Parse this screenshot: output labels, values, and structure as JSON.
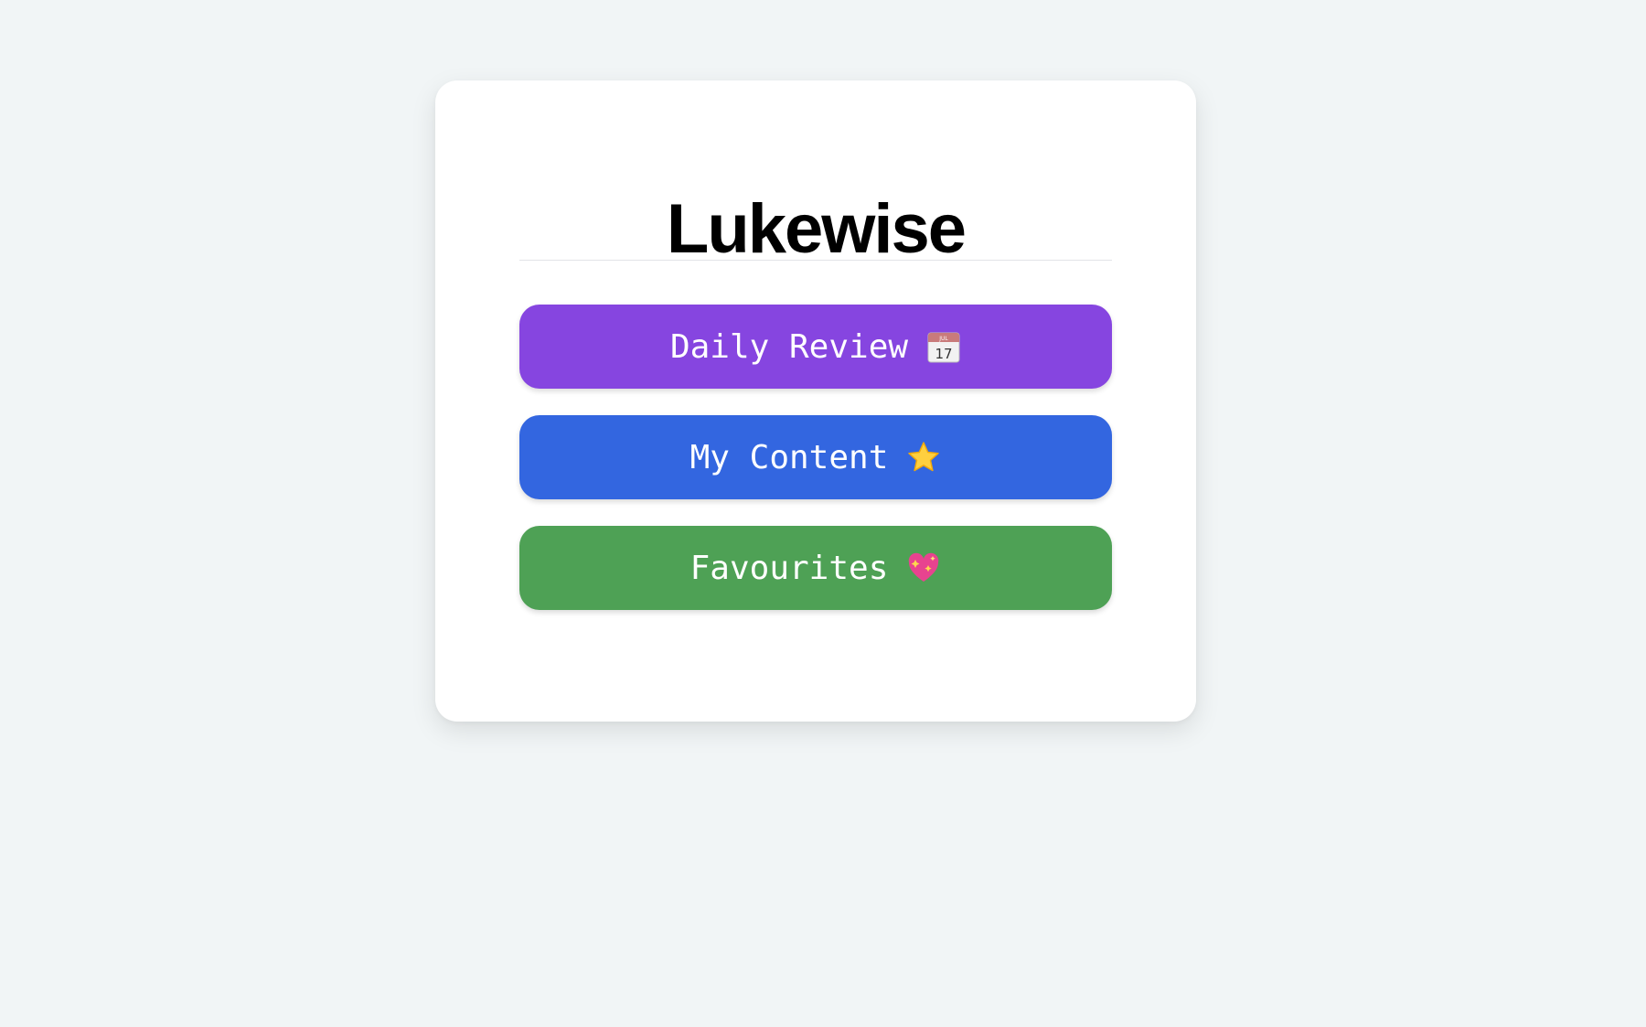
{
  "app": {
    "title": "Lukewise"
  },
  "menu": {
    "items": [
      {
        "label": "Daily Review",
        "icon": "calendar-icon",
        "color": "#8645e0"
      },
      {
        "label": "My Content",
        "icon": "star-icon",
        "color": "#3366e0"
      },
      {
        "label": "Favourites",
        "icon": "sparkling-heart-icon",
        "color": "#4ea155"
      }
    ]
  },
  "colors": {
    "background": "#f1f5f6",
    "card": "#ffffff",
    "title_text": "#000000",
    "button_text": "#ffffff"
  }
}
